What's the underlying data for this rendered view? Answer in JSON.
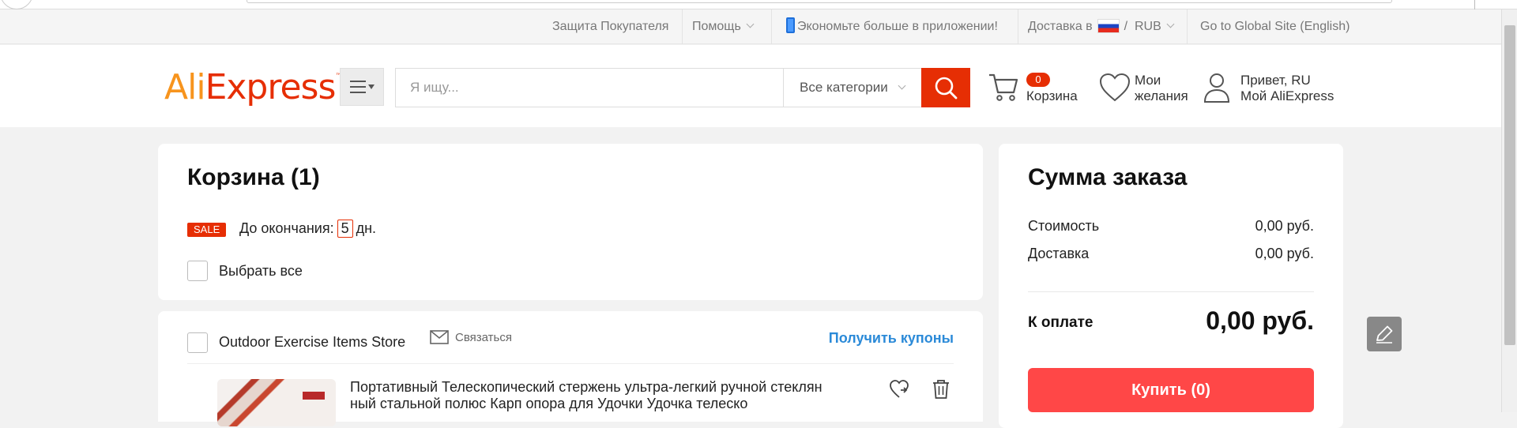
{
  "topnav": {
    "buyer_protection": "Защита Покупателя",
    "help": "Помощь",
    "app_promo": "Экономьте больше в приложении!",
    "delivery_prefix": "Доставка в",
    "delivery_sep": "/",
    "currency": "RUB",
    "global_site": "Go to Global Site (English)"
  },
  "header": {
    "logo": {
      "part1": "Ali",
      "part2": "Express",
      "tm": "™"
    },
    "search_placeholder": "Я ищу...",
    "category": "Все категории",
    "cart_count": "0",
    "cart_label": "Корзина",
    "wishlist_line1": "Мои",
    "wishlist_line2": "желания",
    "greeting": "Привет, RU",
    "my_account": "Мой AliExpress"
  },
  "cart": {
    "title": "Корзина (1)",
    "sale_badge": "SALE",
    "countdown_prefix": "До окончания:",
    "countdown_days": "5",
    "countdown_suffix": "дн.",
    "select_all": "Выбрать все"
  },
  "store": {
    "name": "Outdoor Exercise Items Store",
    "contact": "Связаться",
    "coupons": "Получить купоны",
    "product_title": "Портативный Телескопический стержень ультра-легкий ручной стеклянный стальной полюс Карп опора для Удочки Удочка телеско"
  },
  "summary": {
    "title": "Сумма заказа",
    "cost_label": "Стоимость",
    "cost_value": "0,00 руб.",
    "delivery_label": "Доставка",
    "delivery_value": "0,00 руб.",
    "pay_label": "К оплате",
    "pay_value": "0,00 руб.",
    "buy_button": "Купить (0)"
  },
  "colors": {
    "brand_red": "#e62e04",
    "buy_red": "#ff4747",
    "link_blue": "#2b8ad8",
    "logo_orange": "#f7941d"
  }
}
